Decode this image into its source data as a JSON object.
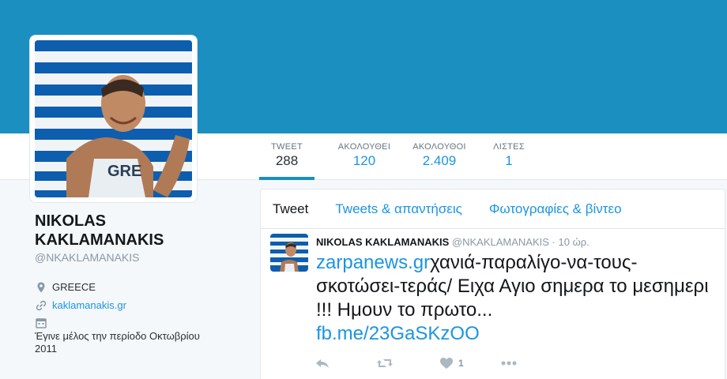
{
  "profile": {
    "name_line1": "NIKOLAS",
    "name_line2": "KAKLAMANAKIS",
    "handle": "@NKAKLAMANAKIS",
    "location": "GREECE",
    "website": "kaklamanakis.gr",
    "joined_line1": "Έγινε μέλος την περίοδο Οκτωβρίου",
    "joined_line2": "2011"
  },
  "nav": [
    {
      "label": "TWEET",
      "value": "288"
    },
    {
      "label": "ΑΚΟΛΟΥΘΕΙ",
      "value": "120"
    },
    {
      "label": "ΑΚΟΛΟΥΘΟΙ",
      "value": "2.409"
    },
    {
      "label": "ΛΙΣΤΕΣ",
      "value": "1"
    }
  ],
  "tabs": [
    "Tweet",
    "Tweets & απαντήσεις",
    "Φωτογραφίες & βίντεο"
  ],
  "tweet": {
    "name": "NIKOLAS KAKLAMANAKIS",
    "handle": "@NKAKLAMANAKIS",
    "separator": "·",
    "time": "10 ώρ.",
    "link1": "zarpanews.gr",
    "text1": "χανιά-παραλίγο-να-τους-σκοτώσει-τεράς/  Ειχα Αγιο σημερα το μεσημερι !!! Ημουν το πρωτο...",
    "link2": "fb.me/23GaSKzOO",
    "like_count": "1"
  },
  "colors": {
    "banner": "#1b8fbf",
    "accent": "#1b95e0",
    "greek_blue": "#0d5eaf"
  },
  "icons": {
    "location": "map-pin-icon",
    "website": "link-icon",
    "joined": "calendar-icon",
    "reply": "reply-icon",
    "retweet": "retweet-icon",
    "like": "heart-icon",
    "more": "more-dots-icon"
  }
}
